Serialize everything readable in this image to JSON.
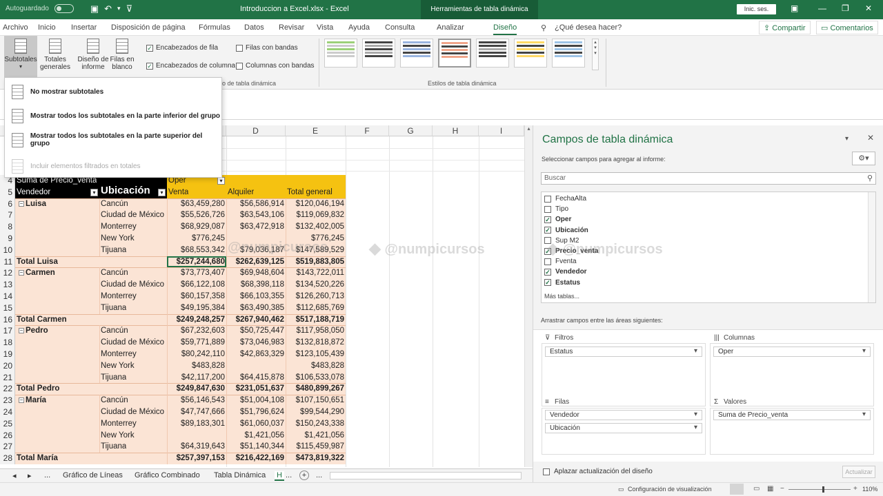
{
  "titlebar": {
    "autosave_label": "Autoguardado",
    "doc_title": "Introduccion a Excel.xlsx  -  Excel",
    "context_tab": "Herramientas de tabla dinámica",
    "signin_label": "Inic. ses."
  },
  "menu": {
    "tabs": [
      "Archivo",
      "Inicio",
      "Insertar",
      "Disposición de página",
      "Fórmulas",
      "Datos",
      "Revisar",
      "Vista",
      "Ayuda",
      "Consulta",
      "Analizar",
      "Diseño"
    ],
    "tell_me": "¿Qué desea hacer?",
    "share": "Compartir",
    "comments": "Comentarios"
  },
  "ribbon": {
    "buttons": [
      "Subtotales",
      "Totales generales",
      "Diseño de informe",
      "Filas en blanco"
    ],
    "options": {
      "row_headers": "Encabezados de fila",
      "col_headers": "Encabezados de columna",
      "banded_rows": "Filas con bandas",
      "banded_cols": "Columnas con bandas"
    },
    "group_options": "ilo de tabla dinámica",
    "group_styles": "Estilos de tabla dinámica",
    "style_colors": [
      "#9bd077",
      "#444444",
      "#9ab5e0",
      "#f0a58a",
      "#444444",
      "#ffd966",
      "#9dc3e6"
    ]
  },
  "subtotals_menu": {
    "items": [
      "No mostrar subtotales",
      "Mostrar todos los subtotales en la parte inferior del grupo",
      "Mostrar todos los subtotales en la parte superior del grupo",
      "Incluir elementos filtrados en totales"
    ]
  },
  "grid": {
    "col_headers": [
      "D",
      "E",
      "F",
      "G",
      "H",
      "I"
    ],
    "row_numbers": [
      "4",
      "5",
      "6",
      "7",
      "8",
      "9",
      "10",
      "11",
      "12",
      "13",
      "14",
      "15",
      "16",
      "17",
      "18",
      "19",
      "20",
      "21",
      "22",
      "23",
      "24",
      "25",
      "26",
      "27",
      "28"
    ],
    "header_row4": {
      "a": "Suma de Precio_venta",
      "c": "Oper"
    },
    "header_row5": {
      "a": "Vendedor",
      "b": "Ubicación",
      "c": "Venta",
      "d": "Alquiler",
      "e": "Total general"
    },
    "rows": [
      {
        "a": "Luisa",
        "b": "Cancún",
        "c": "$63,459,280",
        "d": "$56,586,914",
        "e": "$120,046,194",
        "kind": "first"
      },
      {
        "a": "",
        "b": "Ciudad de México",
        "c": "$55,526,726",
        "d": "$63,543,106",
        "e": "$119,069,832",
        "kind": "item"
      },
      {
        "a": "",
        "b": "Monterrey",
        "c": "$68,929,087",
        "d": "$63,472,918",
        "e": "$132,402,005",
        "kind": "item"
      },
      {
        "a": "",
        "b": "New York",
        "c": "$776,245",
        "d": "",
        "e": "$776,245",
        "kind": "item"
      },
      {
        "a": "",
        "b": "Tijuana",
        "c": "$68,553,342",
        "d": "$79,036,187",
        "e": "$147,589,529",
        "kind": "item"
      },
      {
        "a": "Total Luisa",
        "b": "",
        "c": "$257,244,680",
        "d": "$262,639,125",
        "e": "$519,883,805",
        "kind": "total"
      },
      {
        "a": "Carmen",
        "b": "Cancún",
        "c": "$73,773,407",
        "d": "$69,948,604",
        "e": "$143,722,011",
        "kind": "first"
      },
      {
        "a": "",
        "b": "Ciudad de México",
        "c": "$66,122,108",
        "d": "$68,398,118",
        "e": "$134,520,226",
        "kind": "item"
      },
      {
        "a": "",
        "b": "Monterrey",
        "c": "$60,157,358",
        "d": "$66,103,355",
        "e": "$126,260,713",
        "kind": "item"
      },
      {
        "a": "",
        "b": "Tijuana",
        "c": "$49,195,384",
        "d": "$63,490,385",
        "e": "$112,685,769",
        "kind": "item"
      },
      {
        "a": "Total Carmen",
        "b": "",
        "c": "$249,248,257",
        "d": "$267,940,462",
        "e": "$517,188,719",
        "kind": "total"
      },
      {
        "a": "Pedro",
        "b": "Cancún",
        "c": "$67,232,603",
        "d": "$50,725,447",
        "e": "$117,958,050",
        "kind": "first"
      },
      {
        "a": "",
        "b": "Ciudad de México",
        "c": "$59,771,889",
        "d": "$73,046,983",
        "e": "$132,818,872",
        "kind": "item"
      },
      {
        "a": "",
        "b": "Monterrey",
        "c": "$80,242,110",
        "d": "$42,863,329",
        "e": "$123,105,439",
        "kind": "item"
      },
      {
        "a": "",
        "b": "New York",
        "c": "$483,828",
        "d": "",
        "e": "$483,828",
        "kind": "item"
      },
      {
        "a": "",
        "b": "Tijuana",
        "c": "$42,117,200",
        "d": "$64,415,878",
        "e": "$106,533,078",
        "kind": "item"
      },
      {
        "a": "Total Pedro",
        "b": "",
        "c": "$249,847,630",
        "d": "$231,051,637",
        "e": "$480,899,267",
        "kind": "total"
      },
      {
        "a": "María",
        "b": "Cancún",
        "c": "$56,146,543",
        "d": "$51,004,108",
        "e": "$107,150,651",
        "kind": "first"
      },
      {
        "a": "",
        "b": "Ciudad de México",
        "c": "$47,747,666",
        "d": "$51,796,624",
        "e": "$99,544,290",
        "kind": "item"
      },
      {
        "a": "",
        "b": "Monterrey",
        "c": "$89,183,301",
        "d": "$61,060,037",
        "e": "$150,243,338",
        "kind": "item"
      },
      {
        "a": "",
        "b": "New York",
        "c": "",
        "d": "$1,421,056",
        "e": "$1,421,056",
        "kind": "item"
      },
      {
        "a": "",
        "b": "Tijuana",
        "c": "$64,319,643",
        "d": "$51,140,344",
        "e": "$115,459,987",
        "kind": "item"
      },
      {
        "a": "Total María",
        "b": "",
        "c": "$257,397,153",
        "d": "$216,422,169",
        "e": "$473,819,322",
        "kind": "total"
      }
    ]
  },
  "watermark": "@numpicursos",
  "sheet_tabs": {
    "items": [
      "...",
      "Gráfico de Líneas",
      "Gráfico Combinado",
      "Tabla Dinámica",
      "...",
      "..."
    ]
  },
  "status": {
    "view_settings": "Configuración de visualización",
    "zoom": "110%"
  },
  "pane": {
    "title": "Campos de tabla dinámica",
    "subtitle": "Seleccionar campos para agregar al informe:",
    "search_placeholder": "Buscar",
    "fields": [
      {
        "name": "FechaAlta",
        "checked": false
      },
      {
        "name": "Tipo",
        "checked": false
      },
      {
        "name": "Oper",
        "checked": true
      },
      {
        "name": "Ubicación",
        "checked": true
      },
      {
        "name": "Sup M2",
        "checked": false
      },
      {
        "name": "Precio_venta",
        "checked": true
      },
      {
        "name": "Fventa",
        "checked": false
      },
      {
        "name": "Vendedor",
        "checked": true
      },
      {
        "name": "Estatus",
        "checked": true
      }
    ],
    "more_tables": "Más tablas...",
    "drag_label": "Arrastrar campos entre las áreas siguientes:",
    "areas": {
      "filters": {
        "label": "Filtros",
        "items": [
          "Estatus"
        ]
      },
      "columns": {
        "label": "Columnas",
        "items": [
          "Oper"
        ]
      },
      "rows": {
        "label": "Filas",
        "items": [
          "Vendedor",
          "Ubicación"
        ]
      },
      "values": {
        "label": "Valores",
        "items": [
          "Suma de Precio_venta"
        ]
      }
    },
    "defer_label": "Aplazar actualización del diseño",
    "update_label": "Actualizar"
  }
}
